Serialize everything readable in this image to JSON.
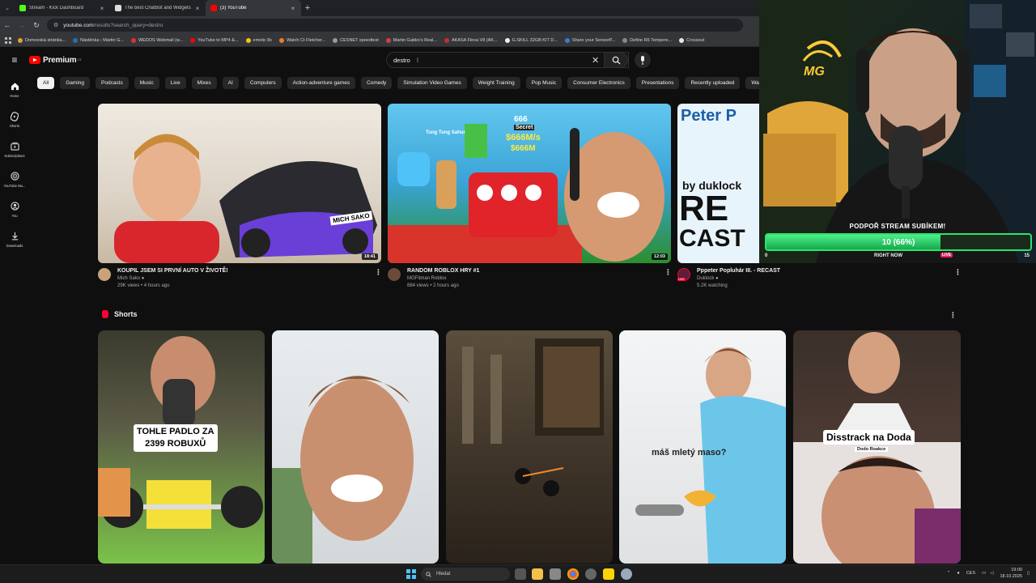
{
  "browser": {
    "tabs": [
      {
        "title": "Stream - Kick Dashboard",
        "color": "#53fc18",
        "active": false
      },
      {
        "title": "The best ChatBot and Widgets",
        "color": "#ffffff",
        "active": false
      },
      {
        "title": "(3) YouTube",
        "color": "#ff0000",
        "active": true
      }
    ],
    "url_host": "youtube.com",
    "url_path": "/results?search_query=destro",
    "bookmarks": [
      "Domovská stránka...",
      "Nástěnka ‹ Martin G...",
      "WEDOS Webmail (w...",
      "YouTube to MP4 &...",
      "emotic 8x",
      "Watch Ct Fletcher...",
      "CESNET speedtest",
      "Martin Gabko's Real...",
      "AKASA Flexa V8 (AK...",
      "G.SKILL 32GB KIT D...",
      "Share your SensorP...",
      "Define R6 Tempere...",
      "Crossout"
    ]
  },
  "youtube": {
    "logo_text": "Premium",
    "logo_country": "CZ",
    "search_query": "destro",
    "rail": [
      {
        "label": "Home",
        "icon": "home-icon"
      },
      {
        "label": "Shorts",
        "icon": "shorts-icon"
      },
      {
        "label": "Subscriptions",
        "icon": "subscriptions-icon"
      },
      {
        "label": "YouTube Mu...",
        "icon": "youtube-music-icon"
      },
      {
        "label": "You",
        "icon": "you-icon"
      },
      {
        "label": "Downloads",
        "icon": "downloads-icon"
      }
    ],
    "chips": [
      "All",
      "Gaming",
      "Podcasts",
      "Music",
      "Live",
      "Mixes",
      "AI",
      "Computers",
      "Action-adventure games",
      "Comedy",
      "Simulation Video Games",
      "Weight Training",
      "Pop Music",
      "Consumer Electronics",
      "Presentations",
      "Recently uploaded",
      "Wa"
    ],
    "videos": [
      {
        "title": "KOUPIL JSEM SI PRVNÍ AUTO V ŽIVOTĚ!",
        "channel": "Mich Sako",
        "meta": "29K views • 4 hours ago",
        "duration": "18:41",
        "thumb_text": "MICH SAKO"
      },
      {
        "title": "RANDOM ROBLOX HRY #1",
        "channel": "MGFitman Roblox",
        "meta": "884 views • 2 hours ago",
        "duration": "12:03",
        "thumb_text_1": "666",
        "thumb_text_2": "Secret",
        "thumb_text_3": "$666M/s",
        "thumb_text_4": "$666M",
        "thumb_text_5": "Tung Tung Sahur"
      },
      {
        "title": "Pppeter Popluhár III. - RECAST",
        "channel": "Duklock",
        "meta": "5.2K watching",
        "live_label": "LIVE",
        "thumb_text_1": "Peter P",
        "thumb_text_2": "by duklock",
        "thumb_text_3": "RE",
        "thumb_text_4": "CAST"
      }
    ],
    "shorts_title": "Shorts",
    "shorts": [
      {
        "caption": "TOHLE PADLO ZA\n2399 ROBUXŮ"
      },
      {
        "caption": ""
      },
      {
        "caption": ""
      },
      {
        "caption": "máš mletý maso?"
      },
      {
        "caption": "Disstrack na Doda",
        "sub": "Dodo Roakce"
      }
    ]
  },
  "overlay": {
    "goal_title": "PODPOŘ STREAM SUBÍKEM!",
    "goal_text": "10 (66%)",
    "goal_fraction": 0.66,
    "goal_min": "0",
    "goal_max": "15",
    "goal_label": "RIGHT NOW",
    "goal_live": "LIVE",
    "sign_text": "MG"
  },
  "taskbar": {
    "search_placeholder": "Hledat",
    "lang": "CES",
    "time": "19:00",
    "date": "18.10.2025"
  }
}
